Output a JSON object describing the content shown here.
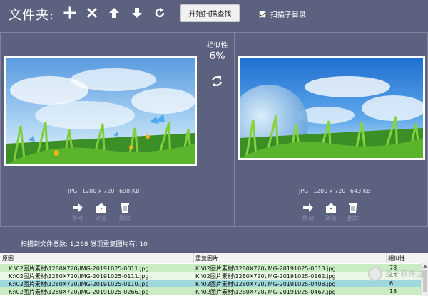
{
  "toolbar": {
    "folder_label": "文件夹:",
    "icons": [
      "add-icon",
      "remove-icon",
      "move-up-icon",
      "move-down-icon",
      "refresh-icon"
    ],
    "scan_button": "开始扫描查找",
    "scan_subdirs_label": "扫描子目录",
    "scan_subdirs_checked": true
  },
  "similarity": {
    "title": "相似性",
    "value": "6%"
  },
  "left_image": {
    "format": "JPG",
    "dimensions": "1280 x 720",
    "size": "698 KB",
    "actions": [
      {
        "label": "移动",
        "icon": "move-arrow-icon"
      },
      {
        "label": "浏览",
        "icon": "browse-icon"
      },
      {
        "label": "删除",
        "icon": "trash-icon"
      }
    ]
  },
  "right_image": {
    "format": "JPG",
    "dimensions": "1280 x 720",
    "size": "643 KB",
    "actions": [
      {
        "label": "移动",
        "icon": "move-arrow-icon"
      },
      {
        "label": "浏览",
        "icon": "browse-icon"
      },
      {
        "label": "删除",
        "icon": "trash-icon"
      }
    ]
  },
  "status": {
    "text": "扫描到文件总数: 1,268  发现重复图片有: 10"
  },
  "table": {
    "columns": [
      "原图",
      "重复图片",
      "相似性"
    ],
    "rows": [
      {
        "original": "K:\\02图片素材\\1280X720\\IMG-20191025-0011.jpg",
        "duplicate": "K:\\02图片素材\\1280X720\\IMG-20191025-0013.jpg",
        "similarity": "78"
      },
      {
        "original": "K:\\02图片素材\\1280X720\\IMG-20191025-0111.jpg",
        "duplicate": "K:\\02图片素材\\1280X720\\IMG-20191025-0162.jpg",
        "similarity": "43"
      },
      {
        "original": "K:\\02图片素材\\1280X720\\IMG-20191025-0110.jpg",
        "duplicate": "K:\\02图片素材\\1280X720\\IMG-20191025-0408.jpg",
        "similarity": "6"
      },
      {
        "original": "K:\\02图片素材\\1280X720\\IMG-20191025-0266.jpg",
        "duplicate": "K:\\02图片素材\\1280X720\\IMG-20191025-0467.jpg",
        "similarity": "18"
      }
    ],
    "row_colors": [
      "#c9ecc3",
      "#e9f7e5",
      "#9ed7dc",
      "#c9ecc3"
    ]
  },
  "watermark": {
    "line1": "当下软件园"
  },
  "colors": {
    "background": "#5c6180",
    "accent_disabled": "#8d91ab"
  }
}
